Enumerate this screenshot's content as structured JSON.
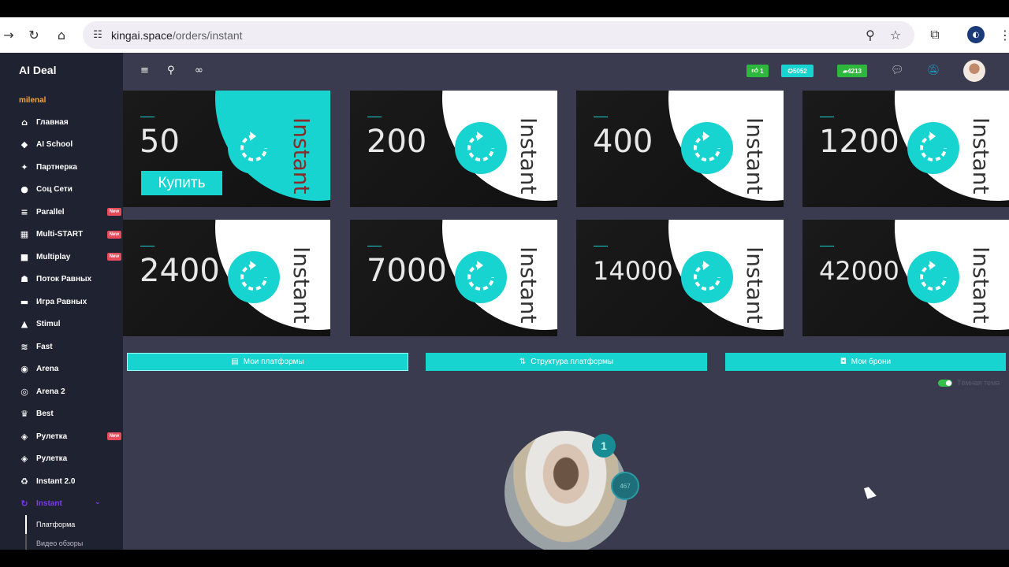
{
  "browser": {
    "host": "kingai.space",
    "path": "/orders/instant"
  },
  "sidebar": {
    "brand": "AI Deal",
    "user": "milenal",
    "items": [
      {
        "label": "Главная",
        "icon": "home-icon",
        "glyph": "⌂",
        "badge": ""
      },
      {
        "label": "AI School",
        "icon": "school-icon",
        "glyph": "◆",
        "badge": ""
      },
      {
        "label": "Партнерка",
        "icon": "handshake-icon",
        "glyph": "✦",
        "badge": ""
      },
      {
        "label": "Соц Сети",
        "icon": "chat-icon",
        "glyph": "●",
        "badge": ""
      },
      {
        "label": "Parallel",
        "icon": "layers-icon",
        "glyph": "≡",
        "badge": "New"
      },
      {
        "label": "Multi-START",
        "icon": "grid-icon",
        "glyph": "▦",
        "badge": "New"
      },
      {
        "label": "Multiplay",
        "icon": "cube-icon",
        "glyph": "■",
        "badge": "New"
      },
      {
        "label": "Поток Равных",
        "icon": "people-icon",
        "glyph": "☗",
        "badge": ""
      },
      {
        "label": "Игра Равных",
        "icon": "gamepad-icon",
        "glyph": "▬",
        "badge": ""
      },
      {
        "label": "Stimul",
        "icon": "triangle-icon",
        "glyph": "▲",
        "badge": ""
      },
      {
        "label": "Fast",
        "icon": "fast-icon",
        "glyph": "≋",
        "badge": ""
      },
      {
        "label": "Arena",
        "icon": "circle-icon",
        "glyph": "◉",
        "badge": ""
      },
      {
        "label": "Arena 2",
        "icon": "target-icon",
        "glyph": "◎",
        "badge": ""
      },
      {
        "label": "Best",
        "icon": "crown-icon",
        "glyph": "♛",
        "badge": ""
      },
      {
        "label": "Рулетка",
        "icon": "dice-icon",
        "glyph": "◈",
        "badge": "New"
      },
      {
        "label": "Рулетка",
        "icon": "dice-icon",
        "glyph": "◈",
        "badge": ""
      },
      {
        "label": "Instant 2.0",
        "icon": "recycle-icon",
        "glyph": "♻",
        "badge": ""
      },
      {
        "label": "Instant",
        "icon": "refresh-icon",
        "glyph": "↻",
        "badge": ""
      }
    ],
    "sub": [
      "Платформа",
      "Видео обзоры"
    ]
  },
  "header": {
    "likes": "1",
    "coins_a": "5052",
    "coins_b": "4213",
    "like_color": "#2db83d",
    "coin_a_color": "#18d4d0",
    "coin_b_color": "#2db83d"
  },
  "cards": {
    "word": "Instant",
    "buy_label": "Купить",
    "amounts": [
      "50",
      "200",
      "400",
      "1200",
      "2400",
      "7000",
      "14000",
      "42000"
    ]
  },
  "buttons": {
    "platforms": "Мои платформы",
    "structure": "Структура платформы",
    "bookings": "Мои брони"
  },
  "theme_label": "Тёмная тема",
  "video": {
    "badge_top": "1",
    "badge_side": "467"
  },
  "colors": {
    "accent": "#18d4d0",
    "sidebar_bg": "#1f2230",
    "main_bg": "#3b3b4f",
    "new_badge": "#e74c5b"
  }
}
